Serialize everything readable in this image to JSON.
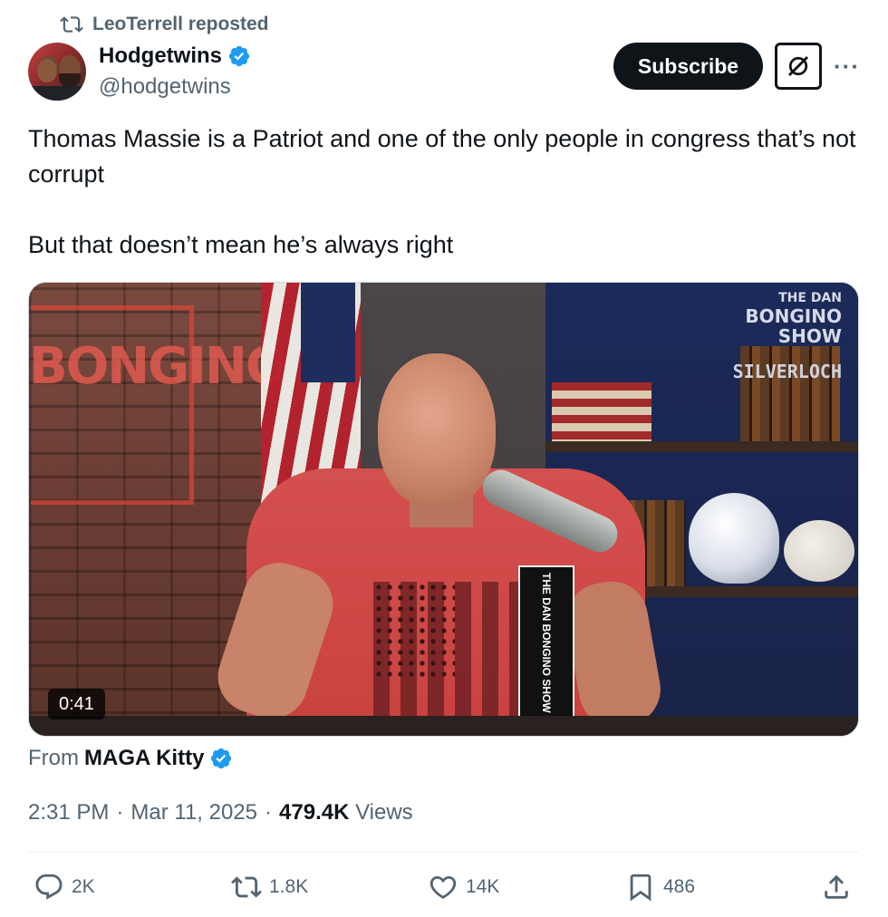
{
  "repost": {
    "label": "LeoTerrell reposted"
  },
  "author": {
    "display_name": "Hodgetwins",
    "handle": "@hodgetwins"
  },
  "buttons": {
    "subscribe": "Subscribe"
  },
  "post": {
    "paragraphs": [
      "Thomas Massie is a Patriot and one of the only people in congress that’s not corrupt",
      "But that doesn’t mean he’s always right"
    ]
  },
  "media": {
    "duration": "0:41",
    "overlay_logo_line1": "THE DAN",
    "overlay_logo_line2": "BONGINO",
    "overlay_logo_line3": "SHOW",
    "overlay_brand": "SILVERLOCH",
    "neon_text": "BONGINO",
    "mic_flag_text": "THE DAN BONGINO SHOW"
  },
  "source": {
    "prefix": "From",
    "name": "MAGA Kitty"
  },
  "meta": {
    "time": "2:31 PM",
    "separator": "·",
    "date": "Mar 11, 2025",
    "views_count": "479.4K",
    "views_label": "Views"
  },
  "actions": {
    "replies": "2K",
    "reposts": "1.8K",
    "likes": "14K",
    "bookmarks": "486"
  },
  "colors": {
    "verified": "#1d9bf0",
    "secondary_text": "#536471",
    "primary_text": "#0f1419"
  }
}
